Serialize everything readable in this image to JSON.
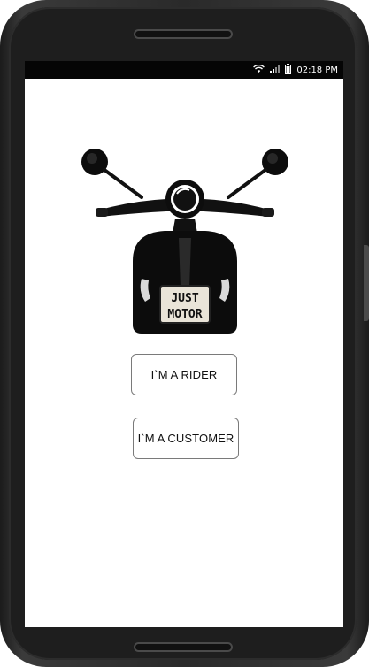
{
  "status_bar": {
    "time": "02:18 PM",
    "icons": [
      "wifi-icon",
      "cell-signal-icon",
      "battery-icon"
    ]
  },
  "logo": {
    "plate_line1": "JUST",
    "plate_line2": "MOTOR"
  },
  "buttons": {
    "rider_label": "I`M A RIDER",
    "customer_label": "I`M A CUSTOMER"
  }
}
